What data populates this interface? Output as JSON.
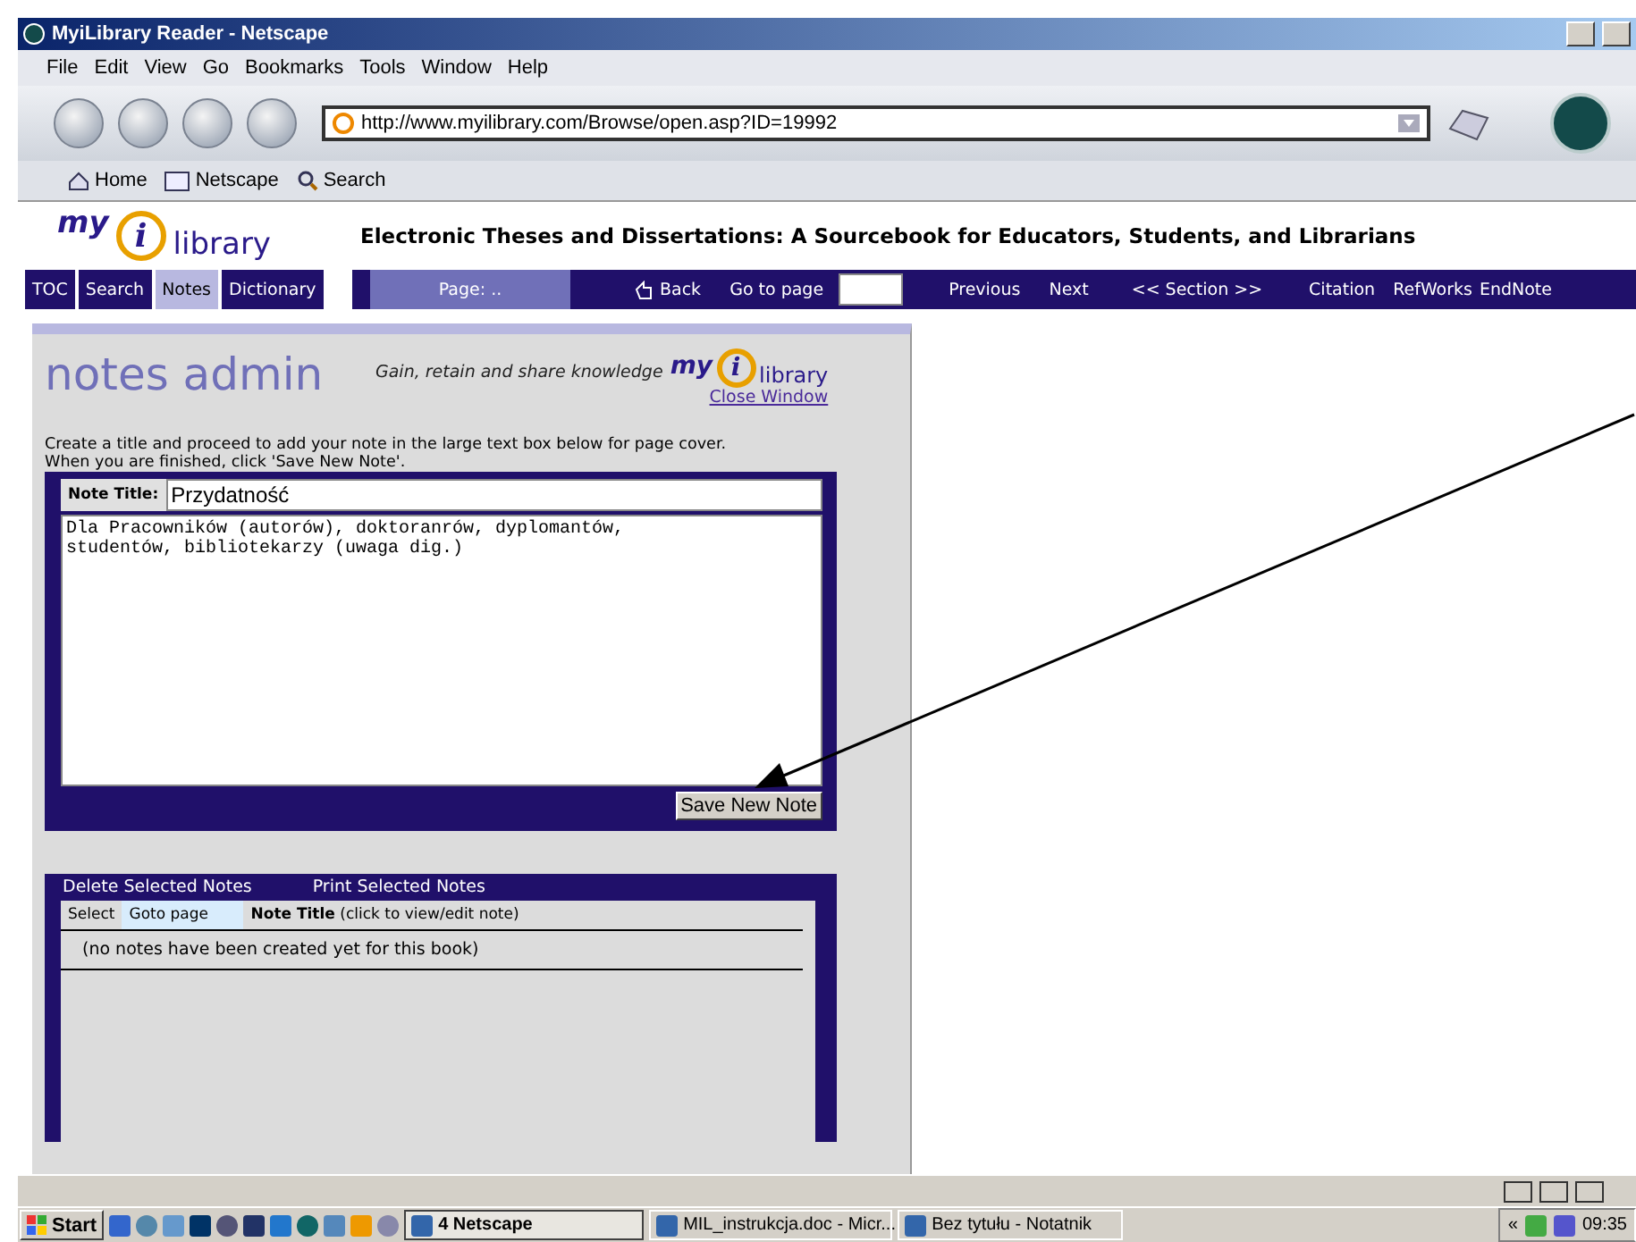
{
  "window": {
    "title": "MyiLibrary Reader - Netscape"
  },
  "menu": [
    "File",
    "Edit",
    "View",
    "Go",
    "Bookmarks",
    "Tools",
    "Window",
    "Help"
  ],
  "address": {
    "url": "http://www.myilibrary.com/Browse/open.asp?ID=19992"
  },
  "personal_toolbar": [
    {
      "label": "Home",
      "kind": "home"
    },
    {
      "label": "Netscape",
      "kind": "my"
    },
    {
      "label": "Search",
      "kind": "search"
    }
  ],
  "site": {
    "logo": {
      "prefix": "my",
      "mark": "i",
      "suffix": "library"
    },
    "book_title": "Electronic Theses and Dissertations: A Sourcebook for Educators, Students, and Librarians",
    "tabs": [
      {
        "label": "TOC",
        "selected": false
      },
      {
        "label": "Search",
        "selected": false
      },
      {
        "label": "Notes",
        "selected": true
      },
      {
        "label": "Dictionary",
        "selected": false
      }
    ],
    "page_label": "Page: ..",
    "nav": [
      {
        "label": "Back",
        "kind": "back"
      },
      {
        "label": "Go to page",
        "kind": "link"
      },
      {
        "kind": "input"
      },
      {
        "label": "Previous",
        "kind": "link"
      },
      {
        "label": "Next",
        "kind": "link"
      },
      {
        "label": "<< Section >>",
        "kind": "link"
      },
      {
        "label": "Citation",
        "kind": "link"
      },
      {
        "label": "RefWorks",
        "kind": "link"
      },
      {
        "label": "EndNote",
        "kind": "link"
      }
    ]
  },
  "notes_admin": {
    "heading": "notes admin",
    "tagline": "Gain, retain and share knowledge",
    "logo": {
      "prefix": "my",
      "mark": "i",
      "suffix": "library"
    },
    "close_link": "Close Window",
    "instructions": [
      "Create a title and proceed to add your note in the large text box below for page cover.",
      "When you are finished, click 'Save New Note'."
    ],
    "note_title_label": "Note Title:",
    "note_title_value": "Przydatność",
    "note_body": "Dla Pracowników (autorów), doktoranrów, dyplomantów,\nstudentów, bibliotekarzy (uwaga dig.)",
    "save_button": "Save New Note",
    "actions": [
      "Delete Selected Notes",
      "Print Selected Notes"
    ],
    "columns": [
      {
        "label": "Select",
        "selected": false
      },
      {
        "label": "Goto page",
        "selected": true
      },
      {
        "label": "**Note Title** (click to view/edit note)",
        "selected": false
      }
    ],
    "empty_message": "(no notes have been created yet for this book)"
  },
  "taskbar": {
    "start": "Start",
    "tasks": [
      {
        "label": "4 Netscape",
        "selected": true
      },
      {
        "label": "MIL_instrukcja.doc - Micr...",
        "selected": false
      },
      {
        "label": "Bez tytułu - Notatnik",
        "selected": false
      }
    ],
    "tray_toggle": "«",
    "clock": "09:35"
  }
}
